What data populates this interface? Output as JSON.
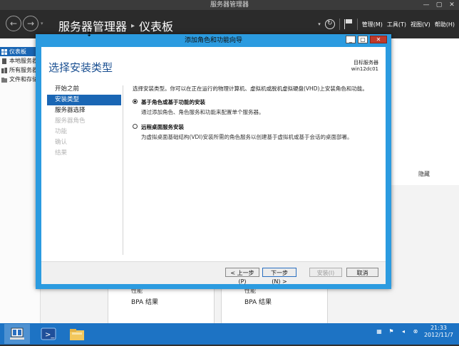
{
  "server_manager": {
    "window_title": "服务器管理器",
    "breadcrumb_root": "服务器管理器",
    "breadcrumb_separator": "▸",
    "breadcrumb_current": "仪表板",
    "menu_manage": "管理(M)",
    "menu_tools": "工具(T)",
    "menu_view": "视图(V)",
    "menu_help": "帮助(H)",
    "sidebar": [
      {
        "label": "仪表板",
        "icon": "dashboard-icon"
      },
      {
        "label": "本地服务器",
        "icon": "server-icon"
      },
      {
        "label": "所有服务器",
        "icon": "servers-icon"
      },
      {
        "label": "文件和存储服务",
        "icon": "file-storage-icon"
      }
    ],
    "tiles": [
      {
        "line1": "性能",
        "line2": "BPA 结果"
      },
      {
        "line1": "性能",
        "line2": "BPA 结果"
      }
    ],
    "hide_label": "隐藏"
  },
  "wizard": {
    "title": "添加角色和功能向导",
    "heading": "选择安装类型",
    "target_label": "目标服务器",
    "target_server": "win12dc01",
    "steps": [
      {
        "label": "开始之前",
        "state": "normal"
      },
      {
        "label": "安装类型",
        "state": "active"
      },
      {
        "label": "服务器选择",
        "state": "normal"
      },
      {
        "label": "服务器角色",
        "state": "disabled"
      },
      {
        "label": "功能",
        "state": "disabled"
      },
      {
        "label": "确认",
        "state": "disabled"
      },
      {
        "label": "结果",
        "state": "disabled"
      }
    ],
    "description": "选择安装类型。你可以在正在运行的物理计算机、虚拟机或脱机虚拟硬盘(VHD)上安装角色和功能。",
    "options": [
      {
        "title": "基于角色或基于功能的安装",
        "desc": "通过添加角色、角色服务和功能来配置单个服务器。",
        "selected": true
      },
      {
        "title": "远程桌面服务安装",
        "desc": "为虚拟桌面基础结构(VDI)安装所需的角色服务以创建基于虚拟机或基于会话的桌面部署。",
        "selected": false
      }
    ],
    "buttons": {
      "prev": "< 上一步(P)",
      "next": "下一步(N) >",
      "install": "安装(I)",
      "cancel": "取消"
    }
  },
  "taskbar": {
    "time": "21:33",
    "date": "2012/11/7"
  }
}
